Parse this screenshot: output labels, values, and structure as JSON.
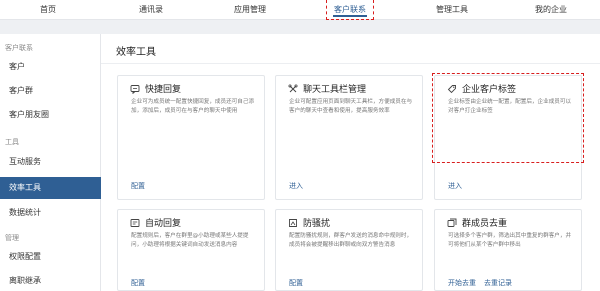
{
  "topnav": {
    "items": [
      {
        "label": "首页"
      },
      {
        "label": "通讯录"
      },
      {
        "label": "应用管理"
      },
      {
        "label": "客户联系"
      },
      {
        "label": "管理工具"
      },
      {
        "label": "我的企业"
      }
    ],
    "active_index": 3
  },
  "sidebar": {
    "group_customer": "客户联系",
    "items_customer": [
      "客户",
      "客户群",
      "客户朋友圈"
    ],
    "group_tools": "工具",
    "items_tools": [
      "互动服务",
      "效率工具",
      "数据统计"
    ],
    "group_manage": "管理",
    "items_manage": [
      "权限配置",
      "离职继承"
    ],
    "active_item": "效率工具"
  },
  "main": {
    "title": "效率工具",
    "cards": [
      {
        "icon": "quick-reply-icon",
        "title": "快捷回复",
        "desc": "企业可为成员统一配置快捷回复，成员还可自己添加，添加后，成员可在与客户的聊天中使用",
        "links": [
          "配置"
        ]
      },
      {
        "icon": "toolbar-icon",
        "title": "聊天工具栏管理",
        "desc": "企业可配置应用页面到聊天工具栏，方便成员在与客户的聊天中查看和使用，提高服务效率",
        "links": [
          "进入"
        ]
      },
      {
        "icon": "tag-icon",
        "title": "企业客户标签",
        "desc": "企业标签由企业统一配置，配置后，企业成员可以对客户打企业标签",
        "links": [
          "进入"
        ]
      },
      {
        "icon": "auto-reply-icon",
        "title": "自动回复",
        "desc": "配置规则后，客户在群里@小助理或某些人提提问，小助理将根据关键词自动发送消息内容",
        "links": [
          "配置"
        ]
      },
      {
        "icon": "anti-harass-icon",
        "title": "防骚扰",
        "desc": "配置防骚扰规则，群客户发送的消息命中规则时，成员将会被提醒移出群聊或向双方警告消息",
        "links": [
          "配置"
        ]
      },
      {
        "icon": "dedupe-icon",
        "title": "群成员去重",
        "desc": "可选择多个客户群，筛选出其中重复的群客户，并可将他们从某个客户群中移出",
        "links": [
          "开始去重",
          "去重记录"
        ]
      }
    ]
  },
  "colors": {
    "accent": "#2f5f94",
    "highlight": "#d81e1e"
  }
}
